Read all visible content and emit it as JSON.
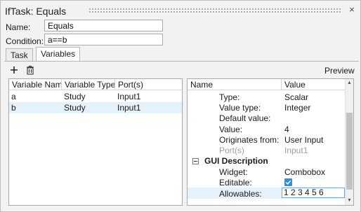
{
  "window": {
    "title": "IfTask: Equals",
    "close_glyph": "×"
  },
  "form": {
    "name_label": "Name:",
    "name_value": "Equals",
    "condition_label": "Condition:",
    "condition_value": "a==b"
  },
  "tabs": [
    {
      "label": "Task",
      "active": false
    },
    {
      "label": "Variables",
      "active": true
    }
  ],
  "toolbar": {
    "add_glyph": "+",
    "delete_icon": "trash-icon",
    "preview_label": "Preview"
  },
  "variables_table": {
    "columns": [
      "Variable Name",
      "Variable Type",
      "Port(s)"
    ],
    "rows": [
      {
        "name": "a",
        "type": "Study",
        "port": "Input1",
        "selected": false
      },
      {
        "name": "b",
        "type": "Study",
        "port": "Input1",
        "selected": true
      }
    ]
  },
  "properties": {
    "columns": [
      "Name",
      "Value"
    ],
    "rows": [
      {
        "name": "Type:",
        "value": "Scalar"
      },
      {
        "name": "Value type:",
        "value": "Integer"
      },
      {
        "name": "Default value:",
        "value": ""
      },
      {
        "name": "Value:",
        "value": "4"
      },
      {
        "name": "Originates from:",
        "value": "User Input"
      },
      {
        "name": "Port(s)",
        "value": "Input1",
        "disabled": true
      }
    ],
    "gui_section": {
      "title": "GUI Description",
      "rows": [
        {
          "name": "Widget:",
          "value": "Combobox"
        },
        {
          "name": "Editable:",
          "checked": true
        },
        {
          "name": "Allowables:",
          "value": "1 2 3 4 5 6"
        }
      ]
    }
  },
  "colors": {
    "accent": "#2f8fd8",
    "selection": "#e6f2fb"
  }
}
